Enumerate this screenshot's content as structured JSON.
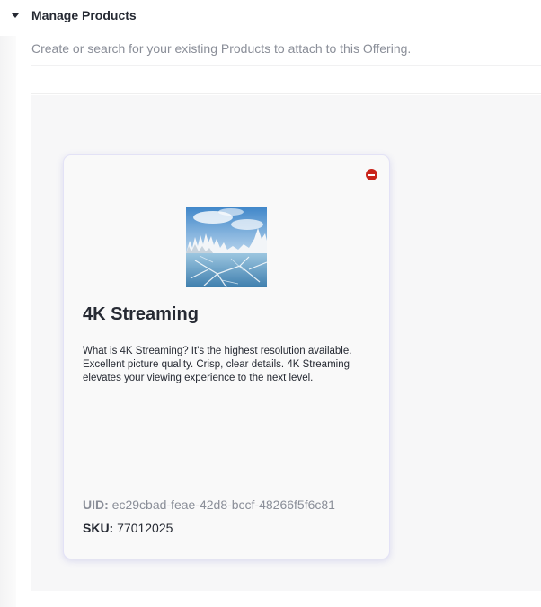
{
  "section": {
    "title": "Manage Products",
    "helper_text": "Create or search for your existing Products to attach to this Offering."
  },
  "product": {
    "title": "4K Streaming",
    "description": "What is 4K Streaming? It's the highest resolution available. Excellent picture quality. Crisp, clear details. 4K Streaming elevates your viewing experience to the next level.",
    "uid_label": "UID:",
    "uid_value": "ec29cbad-feae-42d8-bccf-48266f5f6c81",
    "sku_label": "SKU:",
    "sku_value": "77012025",
    "image_alt": "Frozen lake with snowy pine trees",
    "remove_icon": "remove-circle-icon"
  },
  "colors": {
    "text_primary": "#262a33",
    "text_muted": "#8a8e98",
    "remove_red": "#c9241b",
    "panel_bg": "#f7f7f8",
    "card_bg": "#f9f9f9"
  }
}
